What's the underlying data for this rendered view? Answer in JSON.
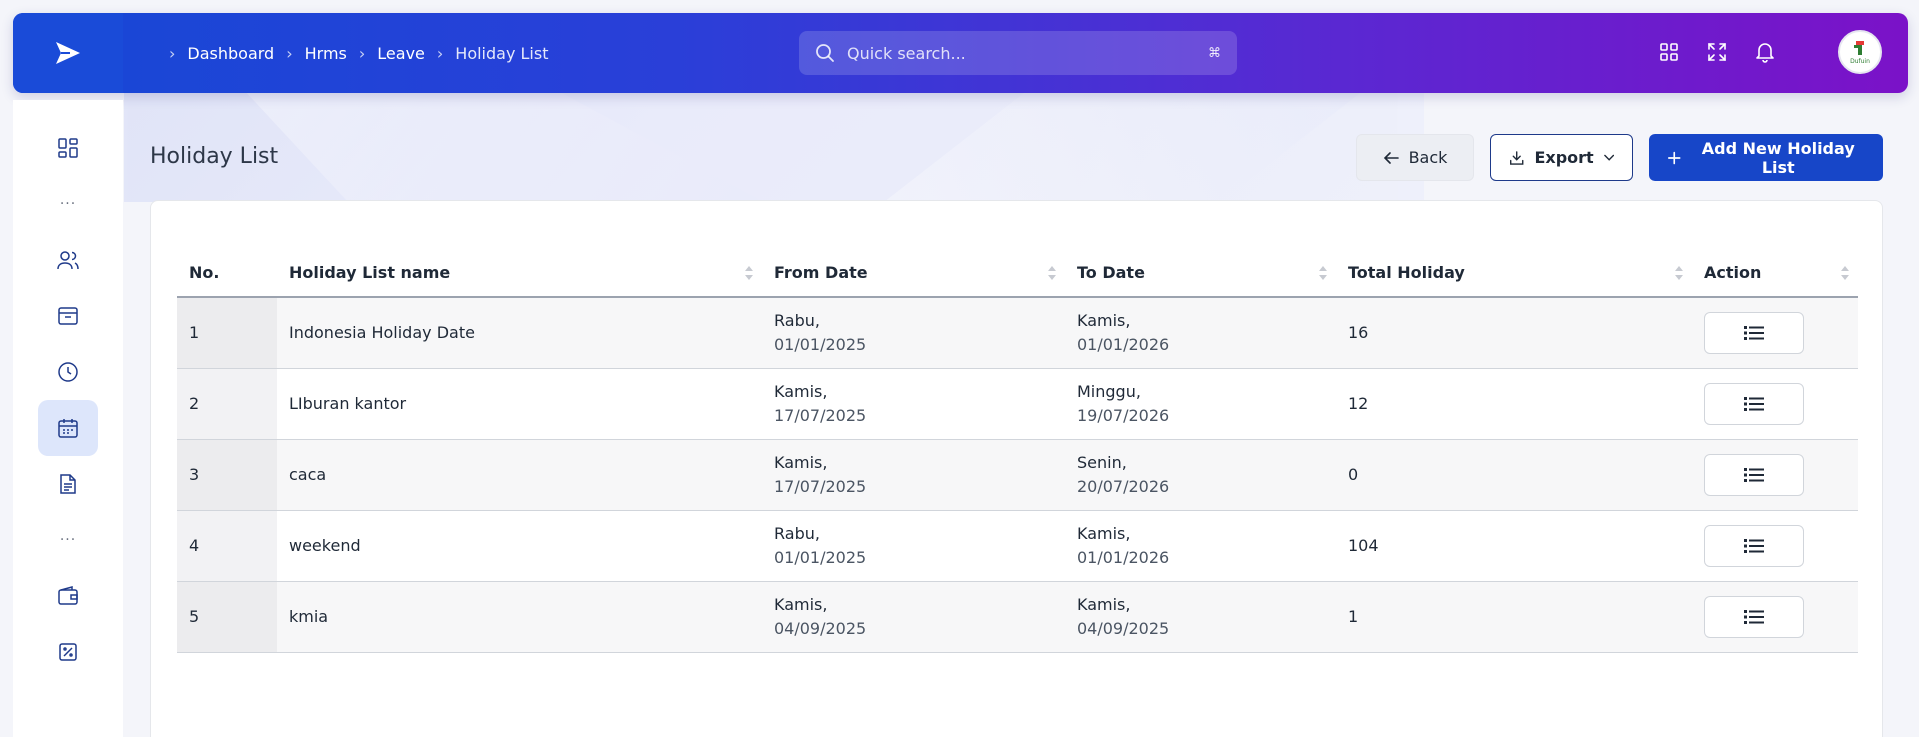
{
  "breadcrumb": [
    "Dashboard",
    "Hrms",
    "Leave",
    "Holiday List"
  ],
  "search": {
    "placeholder": "Quick search...",
    "shortcut": "⌘"
  },
  "avatar_text": "Dufuin",
  "page": {
    "title": "Holiday List",
    "back_label": "Back",
    "export_label": "Export",
    "add_label": "Add New Holiday List"
  },
  "table": {
    "columns": [
      "No.",
      "Holiday List name",
      "From Date",
      "To Date",
      "Total Holiday",
      "Action"
    ],
    "rows": [
      {
        "no": "1",
        "name": "Indonesia Holiday Date",
        "from_day": "Rabu,",
        "from_date": "01/01/2025",
        "to_day": "Kamis,",
        "to_date": "01/01/2026",
        "total": "16"
      },
      {
        "no": "2",
        "name": "LIburan kantor",
        "from_day": "Kamis,",
        "from_date": "17/07/2025",
        "to_day": "Minggu,",
        "to_date": "19/07/2026",
        "total": "12"
      },
      {
        "no": "3",
        "name": "caca",
        "from_day": "Kamis,",
        "from_date": "17/07/2025",
        "to_day": "Senin,",
        "to_date": "20/07/2026",
        "total": "0"
      },
      {
        "no": "4",
        "name": "weekend",
        "from_day": "Rabu,",
        "from_date": "01/01/2025",
        "to_day": "Kamis,",
        "to_date": "01/01/2026",
        "total": "104"
      },
      {
        "no": "5",
        "name": "kmia",
        "from_day": "Kamis,",
        "from_date": "04/09/2025",
        "to_day": "Kamis,",
        "to_date": "04/09/2025",
        "total": "1"
      }
    ]
  },
  "colors": {
    "primary": "#1746c8",
    "topbar_start": "#1748d6",
    "topbar_end": "#7b12c8",
    "sidebar_active": "#dde6fb"
  },
  "sidebar_icons": [
    "dashboard-icon",
    "users-icon",
    "inbox-icon",
    "clock-icon",
    "calendar-icon",
    "document-icon",
    "wallet-icon",
    "percent-icon"
  ]
}
